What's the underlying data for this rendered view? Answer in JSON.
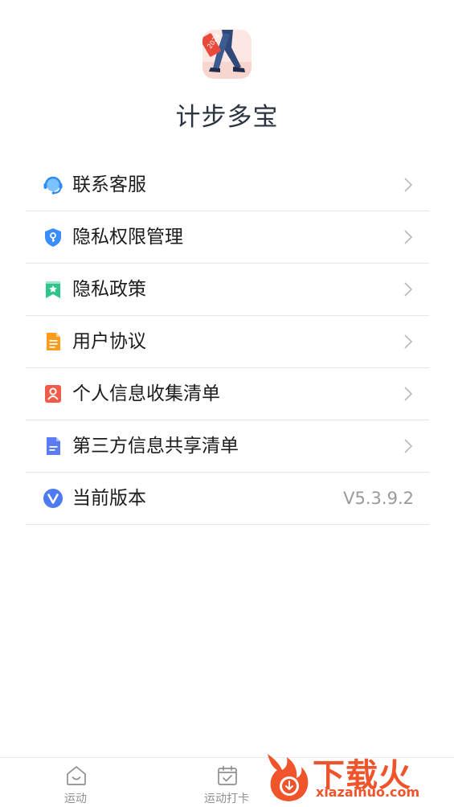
{
  "app": {
    "name": "计步多宝",
    "icon_badge": "2024"
  },
  "menu": {
    "items": [
      {
        "label": "联系客服",
        "icon": "customer-service-headset-icon"
      },
      {
        "label": "隐私权限管理",
        "icon": "privacy-shield-icon"
      },
      {
        "label": "隐私政策",
        "icon": "bookmark-star-icon"
      },
      {
        "label": "用户协议",
        "icon": "document-icon"
      },
      {
        "label": "个人信息收集清单",
        "icon": "person-card-icon"
      },
      {
        "label": "第三方信息共享清单",
        "icon": "shared-list-icon"
      },
      {
        "label": "当前版本",
        "icon": "version-v-icon",
        "value": "V5.3.9.2"
      }
    ]
  },
  "tabbar": {
    "tabs": [
      {
        "label": "运动",
        "icon": "home-smile-icon"
      },
      {
        "label": "运动打卡",
        "icon": "calendar-check-icon"
      }
    ]
  },
  "watermark": {
    "text": "下载火",
    "url": "xiazaihuo.com"
  },
  "colors": {
    "headset_blue": "#2d8cf0",
    "shield_blue": "#3a8dff",
    "bookmark_green": "#2ec58a",
    "document_orange": "#ff9c1a",
    "person_red": "#f25a4a",
    "shared_indigo": "#5b7cf5",
    "version_blue": "#4f7bf0",
    "watermark_orange": "#f0542b"
  }
}
